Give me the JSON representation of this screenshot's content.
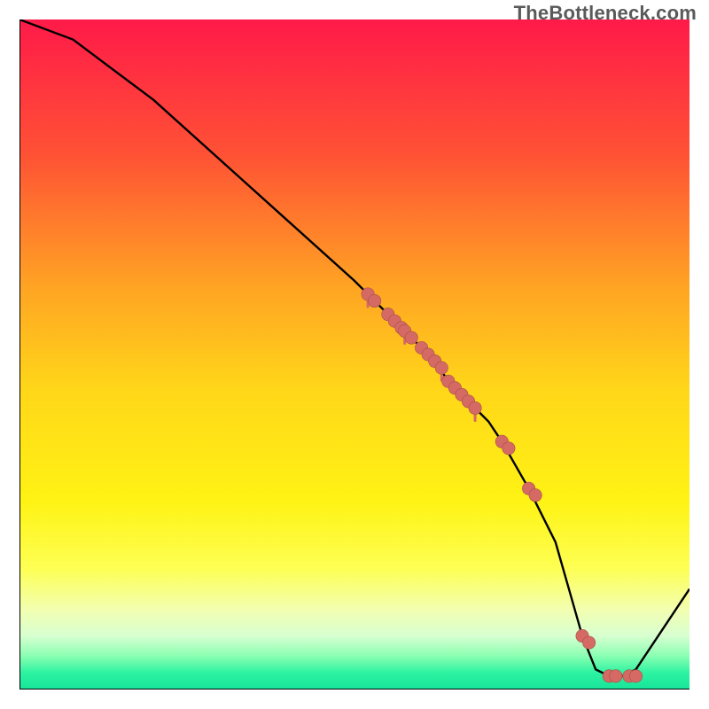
{
  "watermark": "TheBottleneck.com",
  "colors": {
    "line": "#000000",
    "dot_fill": "#d46a63",
    "dot_stroke": "#a94f49",
    "axis": "#000000"
  },
  "gradient_stops": [
    {
      "offset": 0.0,
      "color": "#ff1a49"
    },
    {
      "offset": 0.2,
      "color": "#ff5135"
    },
    {
      "offset": 0.4,
      "color": "#ffa423"
    },
    {
      "offset": 0.55,
      "color": "#ffd619"
    },
    {
      "offset": 0.72,
      "color": "#fff314"
    },
    {
      "offset": 0.82,
      "color": "#fdff54"
    },
    {
      "offset": 0.88,
      "color": "#f3ffb0"
    },
    {
      "offset": 0.92,
      "color": "#d7ffd0"
    },
    {
      "offset": 0.95,
      "color": "#8affb2"
    },
    {
      "offset": 0.975,
      "color": "#2cf3a1"
    },
    {
      "offset": 1.0,
      "color": "#17e499"
    }
  ],
  "chart_data": {
    "type": "line",
    "title": "",
    "xlabel": "",
    "ylabel": "",
    "xlim": [
      0,
      100
    ],
    "ylim": [
      0,
      100
    ],
    "x": [
      0,
      8,
      20,
      30,
      40,
      50,
      52,
      56,
      58,
      60,
      62,
      64,
      66,
      68,
      70,
      72,
      76,
      80,
      82,
      84,
      86,
      88,
      90,
      92,
      100
    ],
    "values": [
      100,
      97,
      88,
      79,
      70,
      61,
      59,
      55,
      53,
      51,
      49,
      46,
      44,
      42,
      40,
      37,
      30,
      22,
      15,
      8,
      3,
      2,
      2,
      3,
      15
    ],
    "series": [
      {
        "name": "points",
        "x": [
          52,
          53,
          55,
          56,
          57,
          57.5,
          58.5,
          60,
          61,
          62,
          63,
          64,
          65,
          66,
          67,
          68,
          72,
          73,
          76,
          77,
          84,
          85,
          88,
          89,
          91,
          92
        ],
        "y": [
          59,
          58,
          56,
          55,
          54,
          53.5,
          52.5,
          51,
          50,
          49,
          48,
          46,
          45,
          44,
          43,
          42,
          37,
          36,
          30,
          29,
          8,
          7,
          2,
          2,
          2,
          2
        ]
      }
    ]
  }
}
